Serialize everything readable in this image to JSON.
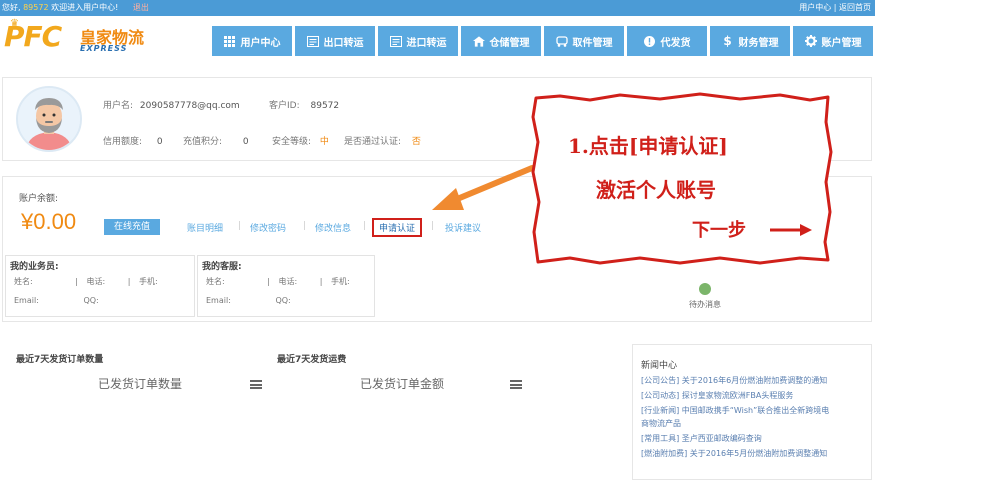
{
  "topbar": {
    "greeting": "您好,",
    "user_id": "89572",
    "welcome": "欢迎进入用户中心!",
    "logout": "退出",
    "right_links": "用户中心 | 返回首页"
  },
  "logo": {
    "mark": "PFC",
    "name": "皇家物流",
    "tagline": "EXPRESS"
  },
  "nav": [
    {
      "label": "用户中心",
      "icon": "grid-icon"
    },
    {
      "label": "出口转运",
      "icon": "document-icon"
    },
    {
      "label": "进口转运",
      "icon": "document-icon"
    },
    {
      "label": "仓储管理",
      "icon": "house-icon"
    },
    {
      "label": "取件管理",
      "icon": "car-icon"
    },
    {
      "label": "代发货",
      "icon": "alert-icon"
    },
    {
      "label": "财务管理",
      "icon": "dollar-icon"
    },
    {
      "label": "账户管理",
      "icon": "gear-icon"
    }
  ],
  "profile": {
    "username_label": "用户名:",
    "username": "2090587778@qq.com",
    "customer_id_label": "客户ID:",
    "customer_id": "89572",
    "credit_label": "信用额度:",
    "credit": "0",
    "points_label": "充值积分:",
    "points": "0",
    "security_label": "安全等级:",
    "security": "中",
    "verified_label": "是否通过认证:",
    "verified": "否"
  },
  "balance": {
    "label": "账户余额:",
    "amount": "¥0.00",
    "recharge": "在线充值",
    "links": [
      "账目明细",
      "修改密码",
      "修改信息",
      "申请认证",
      "投诉建议"
    ]
  },
  "salesperson": {
    "title": "我的业务员:",
    "name": "姓名:",
    "phone": "电话:",
    "mobile": "手机:",
    "email": "Email:",
    "qq": "QQ:"
  },
  "service": {
    "title": "我的客服:",
    "name": "姓名:",
    "phone": "电话:",
    "mobile": "手机:",
    "email": "Email:",
    "qq": "QQ:"
  },
  "message": {
    "label": "待办消息"
  },
  "stats": {
    "orders_title": "最近7天发货订单数量",
    "orders_chart": "已发货订单数量",
    "fees_title": "最近7天发货运费",
    "fees_chart": "已发货订单金额"
  },
  "news": {
    "title": "新闻中心",
    "items": [
      "[公司公告] 关于2016年6月份燃油附加费调整的通知",
      "[公司动态] 探讨皇家物流欧洲FBA头程服务",
      "[行业新闻] 中国邮政携手“Wish”联合推出全新跨境电",
      "商物流产品",
      "[常用工具] 圣卢西亚邮政编码查询",
      "[燃油附加费] 关于2016年5月份燃油附加费调整通知"
    ]
  },
  "callout": {
    "line1": "1.点击[申请认证]",
    "line2": "激活个人账号",
    "line3": "下一步"
  },
  "colors": {
    "brand_blue": "#5aa9e0",
    "accent_orange": "#f08a12",
    "annotation_red": "#d0201a"
  }
}
